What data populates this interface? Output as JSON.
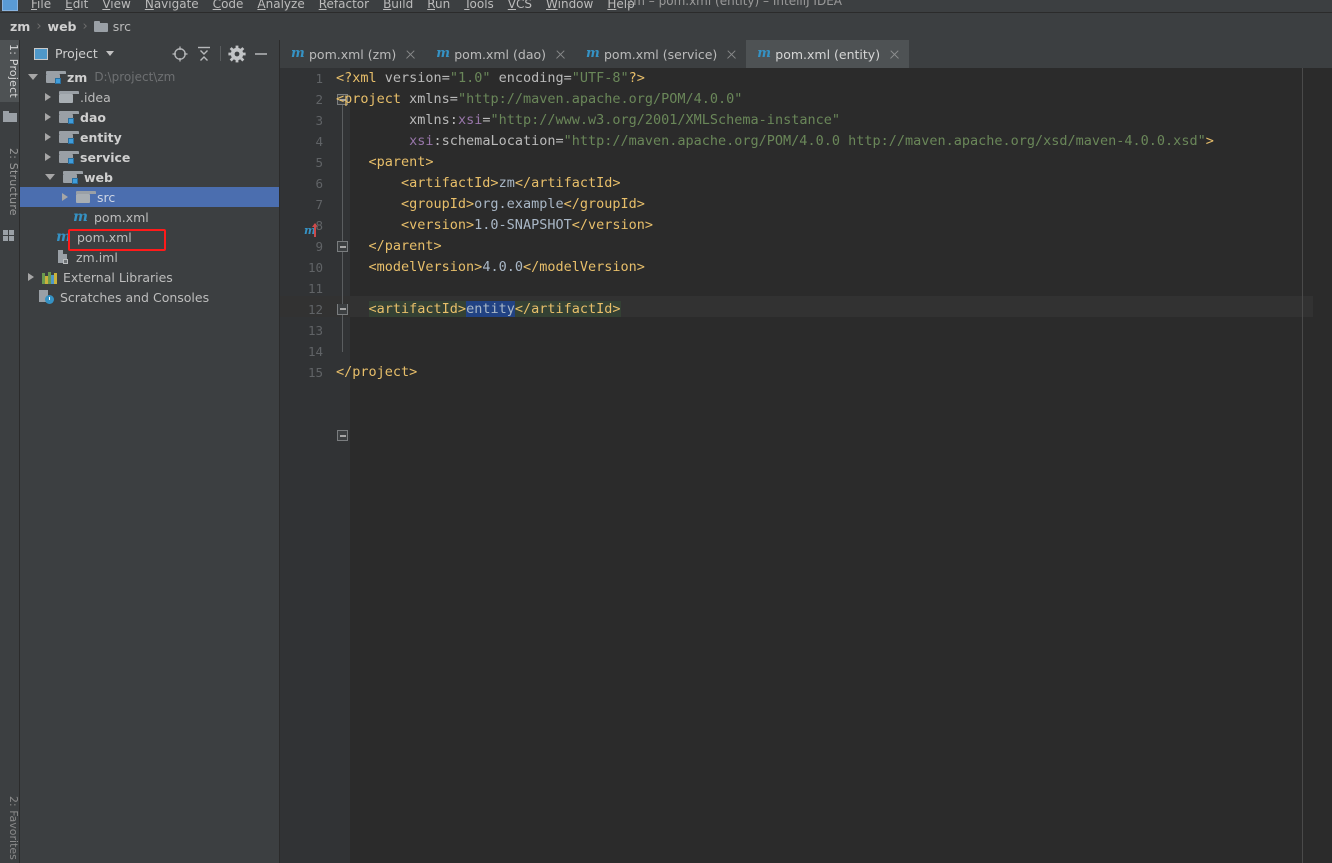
{
  "window": {
    "title": "zm – pom.xml (entity) – IntelliJ IDEA",
    "app_icon": "intellij-idea-icon"
  },
  "menubar": {
    "items": [
      {
        "label": "File"
      },
      {
        "label": "Edit"
      },
      {
        "label": "View"
      },
      {
        "label": "Navigate"
      },
      {
        "label": "Code"
      },
      {
        "label": "Analyze"
      },
      {
        "label": "Refactor"
      },
      {
        "label": "Build"
      },
      {
        "label": "Run"
      },
      {
        "label": "Tools"
      },
      {
        "label": "VCS"
      },
      {
        "label": "Window"
      },
      {
        "label": "Help"
      }
    ]
  },
  "breadcrumb": {
    "items": [
      "zm",
      "web",
      "src"
    ],
    "separator": "›"
  },
  "toolstrip": {
    "left_top": [
      {
        "label": "1: Project",
        "active": true
      },
      {
        "label": "2: Structure",
        "active": false
      }
    ],
    "left_bottom": [
      {
        "label": "2: Favorites"
      }
    ]
  },
  "project_panel": {
    "title": "Project",
    "toolbar": [
      {
        "name": "locate-button",
        "tooltip": "Select Opened File"
      },
      {
        "name": "collapse-all-button",
        "tooltip": "Collapse All"
      },
      {
        "name": "settings-button",
        "tooltip": "Settings"
      },
      {
        "name": "hide-button",
        "tooltip": "Hide"
      }
    ],
    "tree": [
      {
        "label": "zm",
        "detail": "D:\\project\\zm",
        "icon": "module-folder-icon",
        "state": "expanded",
        "indent": 0,
        "bold": true,
        "selected": false
      },
      {
        "label": ".idea",
        "detail": "",
        "icon": "folder-icon",
        "state": "collapsed",
        "indent": 1,
        "bold": false,
        "selected": false
      },
      {
        "label": "dao",
        "detail": "",
        "icon": "module-folder-icon",
        "state": "collapsed",
        "indent": 1,
        "bold": true,
        "selected": false
      },
      {
        "label": "entity",
        "detail": "",
        "icon": "module-folder-icon",
        "state": "collapsed",
        "indent": 1,
        "bold": true,
        "selected": false
      },
      {
        "label": "service",
        "detail": "",
        "icon": "module-folder-icon",
        "state": "collapsed",
        "indent": 1,
        "bold": true,
        "selected": false
      },
      {
        "label": "web",
        "detail": "",
        "icon": "module-folder-icon",
        "state": "expanded",
        "indent": 1,
        "bold": true,
        "selected": false
      },
      {
        "label": "src",
        "detail": "",
        "icon": "folder-icon",
        "state": "collapsed",
        "indent": 2,
        "bold": false,
        "selected": true
      },
      {
        "label": "pom.xml",
        "detail": "",
        "icon": "maven-xml-icon",
        "state": "leaf",
        "indent": 2,
        "bold": false,
        "selected": false
      },
      {
        "label": "pom.xml",
        "detail": "",
        "icon": "maven-xml-icon",
        "state": "leaf",
        "indent": 1,
        "bold": false,
        "selected": false
      },
      {
        "label": "zm.iml",
        "detail": "",
        "icon": "iml-file-icon",
        "state": "leaf",
        "indent": 1,
        "bold": false,
        "selected": false
      },
      {
        "label": "External Libraries",
        "detail": "",
        "icon": "libraries-icon",
        "state": "collapsed",
        "indent": 0,
        "bold": false,
        "selected": false
      },
      {
        "label": "Scratches and Consoles",
        "detail": "",
        "icon": "scratches-icon",
        "state": "leaf",
        "indent": 0,
        "bold": false,
        "selected": false
      }
    ],
    "annotation": {
      "type": "red-rectangle",
      "target": "src",
      "color": "#ff1a1a"
    }
  },
  "editor": {
    "tabs": [
      {
        "label": "pom.xml (zm)",
        "icon": "maven-xml-icon",
        "active": false
      },
      {
        "label": "pom.xml (dao)",
        "icon": "maven-xml-icon",
        "active": false
      },
      {
        "label": "pom.xml (service)",
        "icon": "maven-xml-icon",
        "active": false
      },
      {
        "label": "pom.xml (entity)",
        "icon": "maven-xml-icon",
        "active": true
      }
    ],
    "caret_line": 12,
    "selection": "entity",
    "lines": [
      {
        "n": 1,
        "tokens": [
          {
            "t": "tag",
            "v": "<?xml "
          },
          {
            "t": "attr",
            "v": "version"
          },
          {
            "t": "eq",
            "v": "="
          },
          {
            "t": "str",
            "v": "\"1.0\""
          },
          {
            "t": "attr",
            "v": " encoding"
          },
          {
            "t": "eq",
            "v": "="
          },
          {
            "t": "str",
            "v": "\"UTF-8\""
          },
          {
            "t": "tag",
            "v": "?>"
          }
        ]
      },
      {
        "n": 2,
        "tokens": [
          {
            "t": "tag",
            "v": "<project "
          },
          {
            "t": "attr",
            "v": "xmlns"
          },
          {
            "t": "eq",
            "v": "="
          },
          {
            "t": "str",
            "v": "\"http://maven.apache.org/POM/4.0.0\""
          }
        ]
      },
      {
        "n": 3,
        "tokens": [
          {
            "t": "plain",
            "v": "         "
          },
          {
            "t": "attr",
            "v": "xmlns:"
          },
          {
            "t": "attr-ns",
            "v": "xsi"
          },
          {
            "t": "eq",
            "v": "="
          },
          {
            "t": "str",
            "v": "\"http://www.w3.org/2001/XMLSchema-instance\""
          }
        ]
      },
      {
        "n": 4,
        "tokens": [
          {
            "t": "plain",
            "v": "         "
          },
          {
            "t": "attr-ns",
            "v": "xsi"
          },
          {
            "t": "attr",
            "v": ":schemaLocation"
          },
          {
            "t": "eq",
            "v": "="
          },
          {
            "t": "str",
            "v": "\"http://maven.apache.org/POM/4.0.0 http://maven.apache.org/xsd/maven-4.0.0.xsd\""
          },
          {
            "t": "tag",
            "v": ">"
          }
        ]
      },
      {
        "n": 5,
        "tokens": [
          {
            "t": "tag",
            "v": "    <parent>"
          }
        ]
      },
      {
        "n": 6,
        "tokens": [
          {
            "t": "tag",
            "v": "        <artifactId>"
          },
          {
            "t": "txt",
            "v": "zm"
          },
          {
            "t": "tag",
            "v": "</artifactId>"
          }
        ]
      },
      {
        "n": 7,
        "tokens": [
          {
            "t": "tag",
            "v": "        <groupId>"
          },
          {
            "t": "txt",
            "v": "org.example"
          },
          {
            "t": "tag",
            "v": "</groupId>"
          }
        ]
      },
      {
        "n": 8,
        "tokens": [
          {
            "t": "tag",
            "v": "        <version>"
          },
          {
            "t": "txt",
            "v": "1.0-SNAPSHOT"
          },
          {
            "t": "tag",
            "v": "</version>"
          }
        ]
      },
      {
        "n": 9,
        "tokens": [
          {
            "t": "tag",
            "v": "    </parent>"
          }
        ]
      },
      {
        "n": 10,
        "tokens": [
          {
            "t": "tag",
            "v": "    <modelVersion>"
          },
          {
            "t": "txt",
            "v": "4.0.0"
          },
          {
            "t": "tag",
            "v": "</modelVersion>"
          }
        ]
      },
      {
        "n": 11,
        "tokens": []
      },
      {
        "n": 12,
        "tokens": [
          {
            "t": "plain",
            "v": "    "
          },
          {
            "t": "tag-hl",
            "v": "<artifactId>"
          },
          {
            "t": "txt-sel",
            "v": "entity"
          },
          {
            "t": "tag-hl",
            "v": "</artifactId>"
          }
        ]
      },
      {
        "n": 13,
        "tokens": []
      },
      {
        "n": 14,
        "tokens": []
      },
      {
        "n": 15,
        "tokens": [
          {
            "t": "tag",
            "v": "</project>"
          }
        ]
      }
    ],
    "gutter_markers": [
      {
        "line": 5,
        "icon": "maven-parent-icon"
      }
    ]
  },
  "colors": {
    "background": "#2b2b2b",
    "panel": "#3c3f41",
    "selection_blue": "#4b6eaf",
    "tag_yellow": "#e8bf6a",
    "string_green": "#6a8759",
    "attr_purple": "#9876aa",
    "text_blue_grey": "#a9b7c6",
    "annotation_red": "#ff1a1a",
    "accent_cyan": "#3592c4"
  }
}
